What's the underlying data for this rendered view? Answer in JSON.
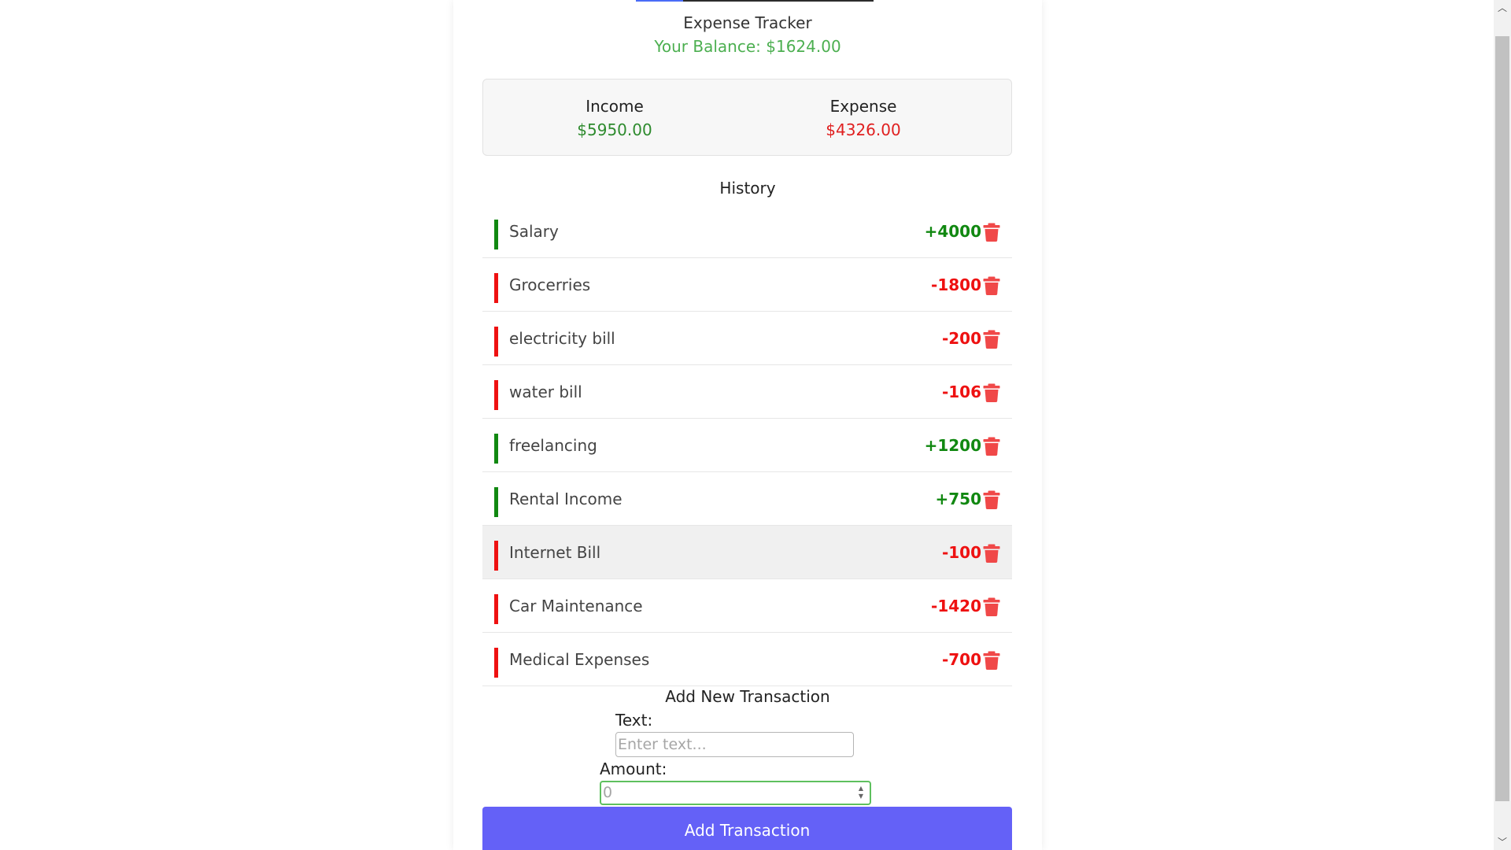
{
  "app": {
    "title": "Expense Tracker",
    "balance": "Your Balance: $1624.00"
  },
  "summary": {
    "income_label": "Income",
    "income_value": "$5950.00",
    "expense_label": "Expense",
    "expense_value": "$4326.00"
  },
  "history": {
    "title": "History",
    "items": [
      {
        "text": "Salary",
        "amount": "+4000",
        "type": "plus"
      },
      {
        "text": "Grocerries",
        "amount": "-1800",
        "type": "minus"
      },
      {
        "text": "electricity bill",
        "amount": "-200",
        "type": "minus"
      },
      {
        "text": "water bill",
        "amount": "-106",
        "type": "minus"
      },
      {
        "text": "freelancing",
        "amount": "+1200",
        "type": "plus"
      },
      {
        "text": "Rental Income",
        "amount": "+750",
        "type": "plus"
      },
      {
        "text": "Internet Bill",
        "amount": "-100",
        "type": "minus"
      },
      {
        "text": "Car Maintenance",
        "amount": "-1420",
        "type": "minus"
      },
      {
        "text": "Medical Expenses",
        "amount": "-700",
        "type": "minus"
      }
    ]
  },
  "form": {
    "title": "Add New Transaction",
    "text_label": "Text:",
    "text_placeholder": "Enter text...",
    "amount_label": "Amount:",
    "amount_value": "0",
    "submit_label": "Add Transaction"
  },
  "colors": {
    "income": "#2e8b2e",
    "expense": "#e02020",
    "balance": "#4caf50",
    "button": "#6461f7",
    "delete_icon": "#f04848"
  },
  "icons": {
    "delete": "trash-icon"
  }
}
